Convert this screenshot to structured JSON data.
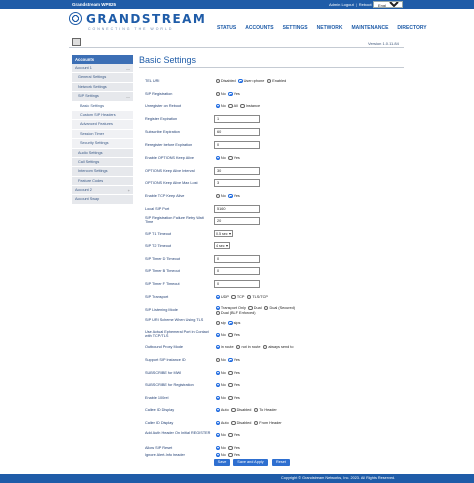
{
  "header": {
    "model": "Grandstream WP825",
    "admin_logout": "Admin Logout",
    "separator": "|",
    "reboot": "Reboot",
    "language": "English"
  },
  "logo": {
    "name": "GRANDSTREAM",
    "tagline": "CONNECTING THE WORLD"
  },
  "nav": [
    "STATUS",
    "ACCOUNTS",
    "SETTINGS",
    "NETWORK",
    "MAINTENANCE",
    "DIRECTORY"
  ],
  "version": "Version 1.0.11.84",
  "sidebar": {
    "header": "Accounts",
    "items": [
      {
        "label": "Account 1",
        "caret": "—"
      },
      {
        "label": "General Settings"
      },
      {
        "label": "Network Settings"
      },
      {
        "label": "SIP Settings",
        "caret": "—"
      },
      {
        "label": "Basic Settings"
      },
      {
        "label": "Custom SIP Headers"
      },
      {
        "label": "Advanced Features"
      },
      {
        "label": "Session Timer"
      },
      {
        "label": "Security Settings"
      },
      {
        "label": "Audio Settings"
      },
      {
        "label": "Call Settings"
      },
      {
        "label": "Intercom Settings"
      },
      {
        "label": "Feature Codes"
      },
      {
        "label": "Account 2",
        "caret": "+"
      },
      {
        "label": "Account Swap"
      }
    ]
  },
  "page_title": "Basic Settings",
  "form": {
    "tel_uri": {
      "label": "TEL URI",
      "options": [
        "Disabled",
        "User=phone",
        "Enabled"
      ],
      "selected": 1
    },
    "sip_registration": {
      "label": "SIP Registration",
      "options": [
        "No",
        "Yes"
      ],
      "selected": 1
    },
    "unregister_on_reboot": {
      "label": "Unregister on Reboot",
      "options": [
        "No",
        "All",
        "Instance"
      ],
      "selected": 0
    },
    "register_expiration": {
      "label": "Register Expiration",
      "value": "1"
    },
    "subscribe_expiration": {
      "label": "Subscribe Expiration",
      "value": "60"
    },
    "reregister_before_expiration": {
      "label": "Reregister before Expiration",
      "value": "0"
    },
    "options_keep_alive": {
      "label": "Enable OPTIONS Keep Alive",
      "options": [
        "No",
        "Yes"
      ],
      "selected": 0
    },
    "options_keep_alive_interval": {
      "label": "OPTIONS Keep Alive Interval",
      "value": "30"
    },
    "options_keep_alive_max_lost": {
      "label": "OPTIONS Keep Alive Max Lost",
      "value": "3"
    },
    "tcp_keep_alive": {
      "label": "Enable TCP Keep Alive",
      "options": [
        "No",
        "Yes"
      ],
      "selected": 1
    },
    "local_sip_port": {
      "label": "Local SIP Port",
      "value": "5160"
    },
    "sip_reg_failure_retry": {
      "label": "SIP Registration Failure Retry Wait Time",
      "value": "20"
    },
    "sip_t1_timeout": {
      "label": "SIP T1 Timeout",
      "value": "0.5 sec"
    },
    "sip_t2_timeout": {
      "label": "SIP T2 Timeout",
      "value": "4 sec"
    },
    "sip_timer_d_timeout": {
      "label": "SIP Timer D Timeout",
      "value": "0"
    },
    "sip_timer_b_timeout": {
      "label": "SIP Timer B Timeout",
      "value": "0"
    },
    "sip_timer_f_timeout": {
      "label": "SIP Timer F Timeout",
      "value": "0"
    },
    "sip_transport": {
      "label": "SIP Transport",
      "options": [
        "UDP",
        "TCP",
        "TLS/TCP"
      ],
      "selected": 0
    },
    "sip_listening_mode": {
      "label": "SIP Listening Mode",
      "options": [
        "Transport Only",
        "Dual",
        "Dual (Secured)",
        "Dual (BLF Enforced)"
      ],
      "selected": 0
    },
    "sip_uri_scheme_tls": {
      "label": "SIP URI Scheme When Using TLS",
      "options": [
        "sip",
        "sips"
      ],
      "selected": 1
    },
    "ephemeral_port": {
      "label": "Use Actual Ephemeral Port in Contact with TCP/TLS",
      "options": [
        "No",
        "Yes"
      ],
      "selected": 0
    },
    "outbound_proxy_mode": {
      "label": "Outbound Proxy Mode",
      "options": [
        "in route",
        "not in route",
        "always send to"
      ],
      "selected": 0
    },
    "sip_instance_id": {
      "label": "Support SIP Instance ID",
      "options": [
        "No",
        "Yes"
      ],
      "selected": 1
    },
    "subscribe_mwi": {
      "label": "SUBSCRIBE for MWI",
      "options": [
        "No",
        "Yes"
      ],
      "selected": 0
    },
    "subscribe_registration": {
      "label": "SUBSCRIBE for Registration",
      "options": [
        "No",
        "Yes"
      ],
      "selected": 0
    },
    "enable_100rel": {
      "label": "Enable 100rel",
      "options": [
        "No",
        "Yes"
      ],
      "selected": 0
    },
    "callee_id_display": {
      "label": "Callee ID Display",
      "options": [
        "Auto",
        "Disabled",
        "To Header"
      ],
      "selected": 0
    },
    "caller_id_display": {
      "label": "Caller ID Display",
      "options": [
        "Auto",
        "Disabled",
        "From Header"
      ],
      "selected": 0
    },
    "auth_header_initial_register": {
      "label": "Add Auth Header On Initial REGISTER",
      "options": [
        "No",
        "Yes"
      ],
      "selected": 0
    },
    "allow_sip_reset": {
      "label": "Allow SIP Reset",
      "options": [
        "No",
        "Yes"
      ],
      "selected": 0
    },
    "ignore_alert_info": {
      "label": "Ignore Alert-Info header",
      "options": [
        "No",
        "Yes"
      ],
      "selected": 0
    }
  },
  "buttons": {
    "save": "Save",
    "save_apply": "Save and Apply",
    "reset": "Reset"
  },
  "footer": "Copyright © Grandstream Networks, Inc. 2023. All Rights Reserved.",
  "colors": {
    "brand": "#1f5ca8",
    "button": "#2e6fd0"
  }
}
